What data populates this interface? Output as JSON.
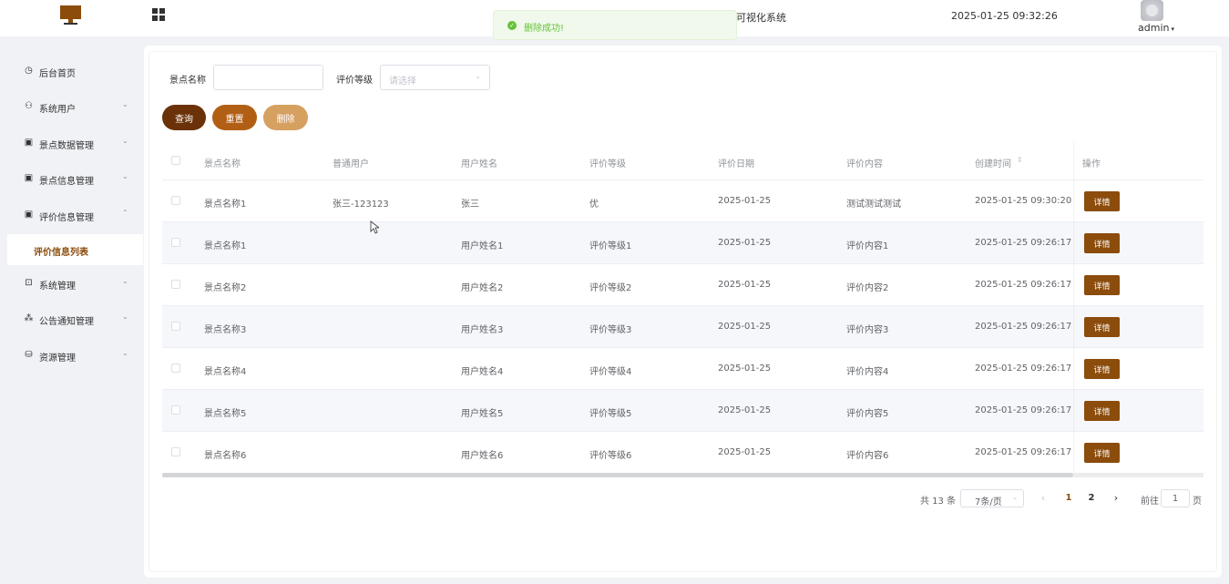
{
  "header": {
    "system_title": "可视化系统",
    "datetime": "2025-01-25 09:32:26",
    "user": "admin",
    "user_caret": "▾",
    "grid_icon": "grid-icon",
    "logo_icon": "monitor-icon"
  },
  "toast": {
    "icon": "check-circle-icon",
    "message": "删除成功!",
    "check_glyph": "✓"
  },
  "sidebar": {
    "items": [
      {
        "label": "后台首页",
        "icon": "◷",
        "arrow": ""
      },
      {
        "label": "系统用户",
        "icon": "⚇",
        "arrow": "⌄"
      },
      {
        "label": "景点数据管理",
        "icon": "▣",
        "arrow": "⌄"
      },
      {
        "label": "景点信息管理",
        "icon": "▣",
        "arrow": "⌄"
      },
      {
        "label": "评价信息管理",
        "icon": "▣",
        "arrow": "⌃"
      },
      {
        "label": "系统管理",
        "icon": "⊡",
        "arrow": "⌄"
      },
      {
        "label": "公告通知管理",
        "icon": "⁂",
        "arrow": "⌄"
      },
      {
        "label": "资源管理",
        "icon": "⛁",
        "arrow": "⌄"
      }
    ],
    "active_sub": "评价信息列表"
  },
  "search": {
    "name_label": "景点名称",
    "name_value": "",
    "level_label": "评价等级",
    "level_placeholder": "请选择",
    "dropdown_glyph": "⌄"
  },
  "buttons": {
    "query": "查询",
    "reset": "重置",
    "delete": "删除"
  },
  "colors": {
    "primary": "#8b4c0c",
    "query_btn": "#6b3108",
    "reset_btn": "#b25f16",
    "delete_btn": "#d6a061",
    "success": "#67c23a"
  },
  "table": {
    "columns": [
      "景点名称",
      "普通用户",
      "用户姓名",
      "评价等级",
      "评价日期",
      "评价内容",
      "创建时间",
      "操作"
    ],
    "sort_glyph": "⇕",
    "rows": [
      {
        "spot": "景点名称1",
        "user": "张三-123123",
        "name": "张三",
        "level": "优",
        "date": "2025-01-25",
        "content": "测试测试测试",
        "created": "2025-01-25 09:30:20",
        "action": "详情"
      },
      {
        "spot": "景点名称1",
        "user": "",
        "name": "用户姓名1",
        "level": "评价等级1",
        "date": "2025-01-25",
        "content": "评价内容1",
        "created": "2025-01-25 09:26:17",
        "action": "详情"
      },
      {
        "spot": "景点名称2",
        "user": "",
        "name": "用户姓名2",
        "level": "评价等级2",
        "date": "2025-01-25",
        "content": "评价内容2",
        "created": "2025-01-25 09:26:17",
        "action": "详情"
      },
      {
        "spot": "景点名称3",
        "user": "",
        "name": "用户姓名3",
        "level": "评价等级3",
        "date": "2025-01-25",
        "content": "评价内容3",
        "created": "2025-01-25 09:26:17",
        "action": "详情"
      },
      {
        "spot": "景点名称4",
        "user": "",
        "name": "用户姓名4",
        "level": "评价等级4",
        "date": "2025-01-25",
        "content": "评价内容4",
        "created": "2025-01-25 09:26:17",
        "action": "详情"
      },
      {
        "spot": "景点名称5",
        "user": "",
        "name": "用户姓名5",
        "level": "评价等级5",
        "date": "2025-01-25",
        "content": "评价内容5",
        "created": "2025-01-25 09:26:17",
        "action": "详情"
      },
      {
        "spot": "景点名称6",
        "user": "",
        "name": "用户姓名6",
        "level": "评价等级6",
        "date": "2025-01-25",
        "content": "评价内容6",
        "created": "2025-01-25 09:26:17",
        "action": "详情"
      }
    ]
  },
  "pagination": {
    "total": "共 13 条",
    "page_size": "7条/页",
    "prev": "‹",
    "next": "›",
    "pages": [
      "1",
      "2"
    ],
    "current": "1",
    "goto_label": "前往",
    "goto_value": "1",
    "page_suffix": "页"
  }
}
